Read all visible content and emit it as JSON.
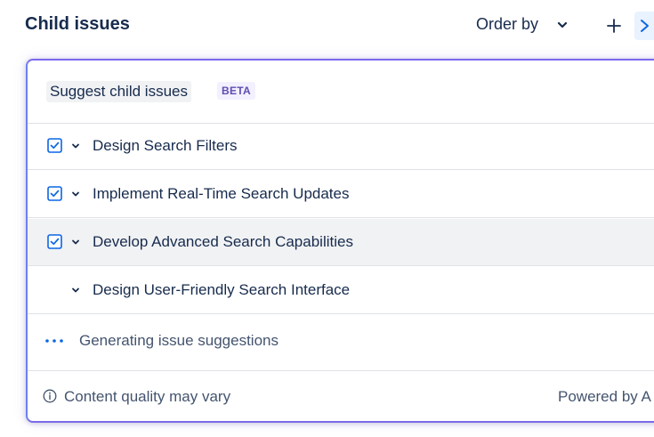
{
  "header": {
    "title": "Child issues",
    "order_by_label": "Order by",
    "icons": {
      "order_chevron": "chevron-down-icon",
      "add": "plus-icon",
      "ai": "ai-sparkle-icon"
    }
  },
  "panel": {
    "suggest_label": "Suggest child issues",
    "beta_badge": "BETA",
    "items": [
      {
        "label": "Design Search Filters",
        "checked": true
      },
      {
        "label": "Implement Real-Time Search Updates",
        "checked": true
      },
      {
        "label": "Develop Advanced Search Capabilities",
        "checked": true
      },
      {
        "label": "Design User-Friendly Search Interface",
        "checked": false
      }
    ],
    "generating_label": "Generating issue suggestions",
    "footer": {
      "quality_note": "Content quality may vary",
      "powered_by": "Powered by A"
    }
  },
  "colors": {
    "accent": "#0c66e4",
    "panel_border": "#7b68ee",
    "beta_text": "#5e4db2",
    "text": "#172b4d",
    "subtle_text": "#44546f"
  }
}
